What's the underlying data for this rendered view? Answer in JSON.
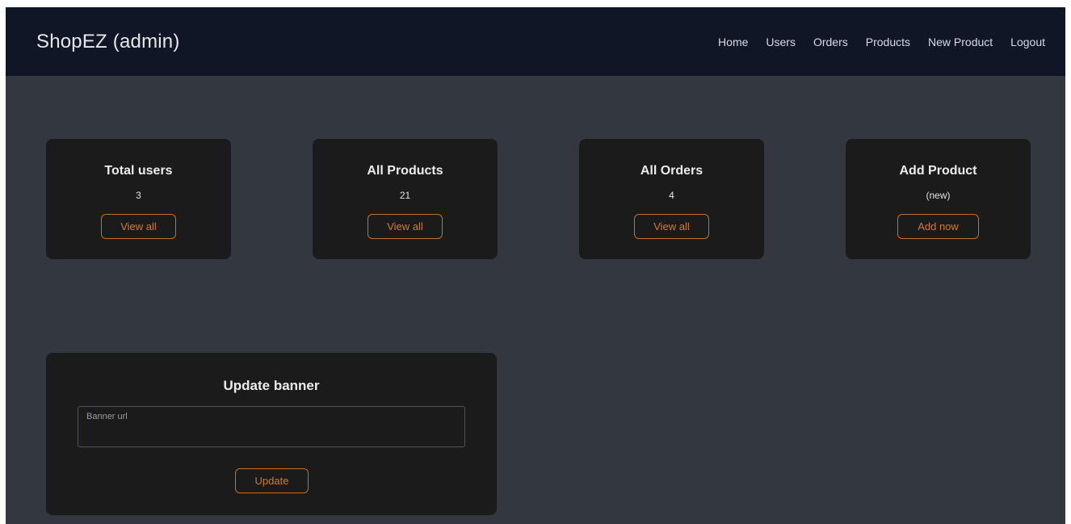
{
  "navbar": {
    "brand": "ShopEZ (admin)",
    "links": [
      {
        "label": "Home"
      },
      {
        "label": "Users"
      },
      {
        "label": "Orders"
      },
      {
        "label": "Products"
      },
      {
        "label": "New Product"
      },
      {
        "label": "Logout"
      }
    ]
  },
  "cards": [
    {
      "title": "Total users",
      "value": "3",
      "button": "View all"
    },
    {
      "title": "All Products",
      "value": "21",
      "button": "View all"
    },
    {
      "title": "All Orders",
      "value": "4",
      "button": "View all"
    },
    {
      "title": "Add Product",
      "value": "(new)",
      "button": "Add now"
    }
  ],
  "banner": {
    "title": "Update banner",
    "input_placeholder": "Banner url",
    "input_value": "",
    "button": "Update"
  },
  "colors": {
    "navbar_bg": "#0f1625",
    "page_bg": "#323740",
    "card_bg": "#1b1b1b",
    "accent": "#d5782f"
  }
}
